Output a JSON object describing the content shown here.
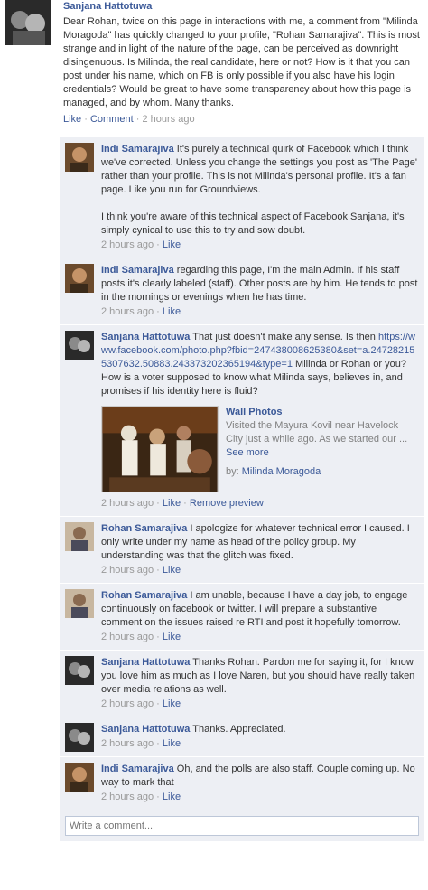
{
  "post": {
    "author": "Sanjana Hattotuwa",
    "text": "Dear Rohan, twice on this page in interactions with me, a comment from \"Milinda Moragoda\" has quickly changed to your profile, \"Rohan Samarajiva\". This is most strange and in light of the nature of the page, can be perceived as downright disingenuous. Is Milinda, the real candidate, here or not? How is it that you can post under his name, which on FB is only possible if you also have his login credentials? Would be great to have some transparency about how this page is managed, and by whom. Many thanks.",
    "like_label": "Like",
    "comment_label": "Comment",
    "sep": "·",
    "time": "2 hours ago"
  },
  "comments": [
    {
      "author": "Indi Samarajiva",
      "text": "It's purely a technical quirk of Facebook which I think we've corrected. Unless you change the settings you post as 'The Page' rather than your profile. This is not Milinda's personal profile. It's a fan page. Like you run for Groundviews.",
      "text2": "I think you're aware of this technical aspect of Facebook Sanjana, it's simply cynical to use this to try and sow doubt.",
      "time": "2 hours ago",
      "like_label": "Like"
    },
    {
      "author": "Indi Samarajiva",
      "text": "regarding this page, I'm the main Admin. If his staff posts it's clearly labeled (staff). Other posts are by him. He tends to post in the mornings or evenings when he has time.",
      "time": "2 hours ago",
      "like_label": "Like"
    },
    {
      "author": "Sanjana Hattotuwa",
      "text_before": "That just doesn't make any sense. Is then",
      "url": "https://www.facebook.com/photo.php?fbid=247438008625380&set=a.247282155307632.50883.243373202365194&type=1",
      "text_after": "Milinda or Rohan or you? How is a voter supposed to know what Milinda says, believes in, and promises if his identity here is fluid?",
      "attachment": {
        "title": "Wall Photos",
        "description": "Visited the Mayura Kovil near Havelock City just a while ago. As we started our ...",
        "see_more": "See more",
        "by_label": "by:",
        "by_name": "Milinda Moragoda"
      },
      "time": "2 hours ago",
      "like_label": "Like",
      "remove_preview": "Remove preview"
    },
    {
      "author": "Rohan Samarajiva",
      "text": "I apologize for whatever technical error I caused. I only write under my name as head of the policy group. My understanding was that the glitch was fixed.",
      "time": "2 hours ago",
      "like_label": "Like"
    },
    {
      "author": "Rohan Samarajiva",
      "text": "I am unable, because I have a day job, to engage continuously on facebook or twitter. I will prepare a substantive comment on the issues raised re RTI and post it hopefully tomorrow.",
      "time": "2 hours ago",
      "like_label": "Like"
    },
    {
      "author": "Sanjana Hattotuwa",
      "text": "Thanks Rohan. Pardon me for saying it, for I know you love him as much as I love Naren, but you should have really taken over media relations as well.",
      "time": "2 hours ago",
      "like_label": "Like"
    },
    {
      "author": "Sanjana Hattotuwa",
      "text": "Thanks. Appreciated.",
      "time": "2 hours ago",
      "like_label": "Like"
    },
    {
      "author": "Indi Samarajiva",
      "text": "Oh, and the polls are also staff. Couple coming up. No way to mark that",
      "time": "2 hours ago",
      "like_label": "Like"
    }
  ],
  "composer": {
    "placeholder": "Write a comment..."
  },
  "colors": {
    "link": "#3b5998",
    "comment_bg": "#edeff4",
    "meta": "#999999"
  }
}
